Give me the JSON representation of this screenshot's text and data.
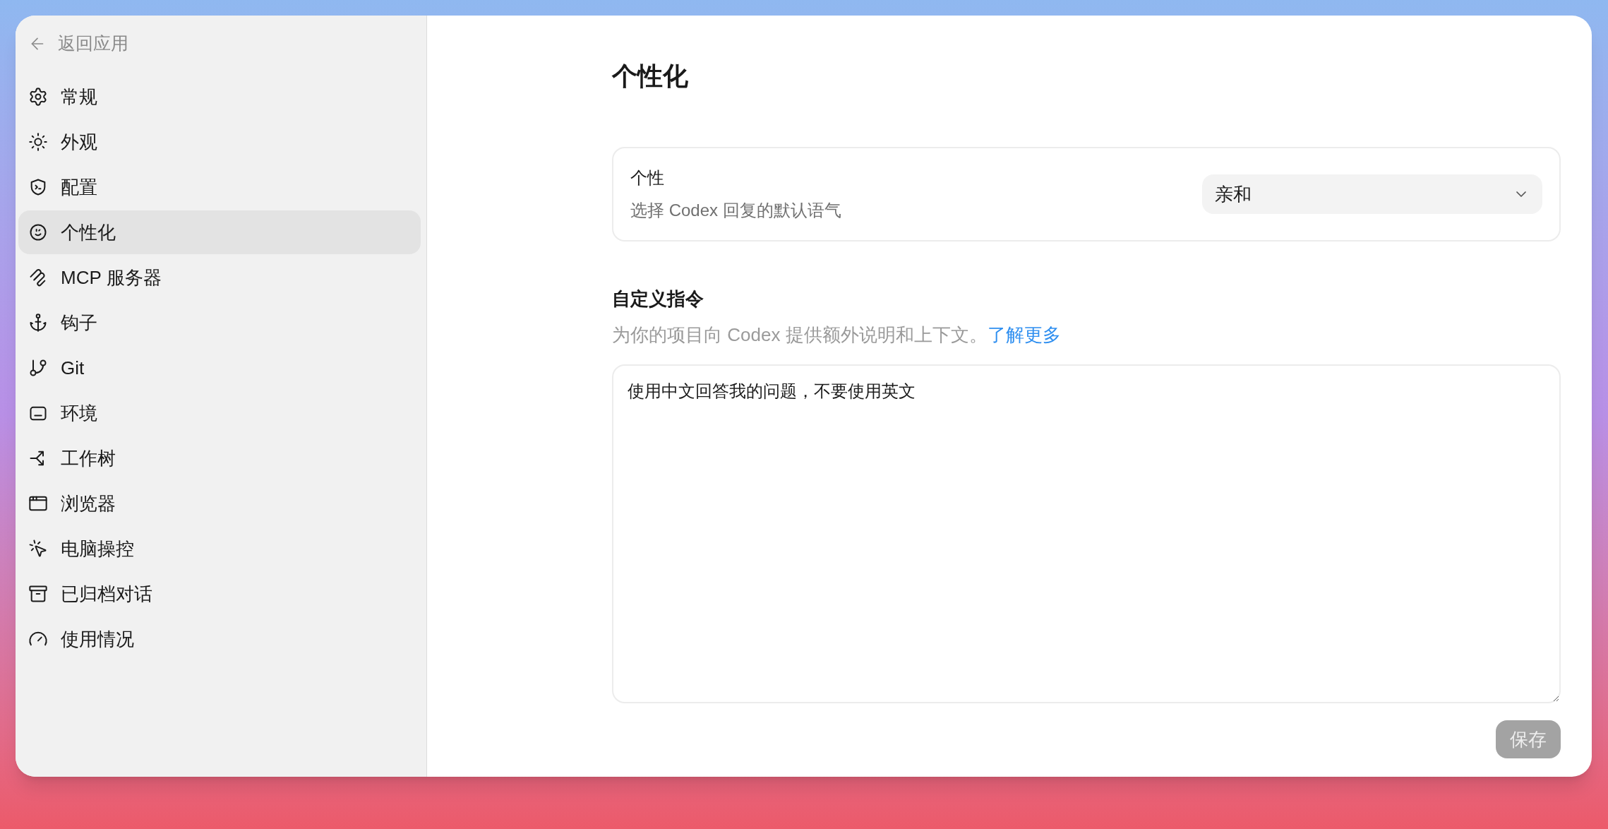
{
  "sidebar": {
    "back": "返回应用",
    "items": [
      {
        "label": "常规",
        "selected": false
      },
      {
        "label": "外观",
        "selected": false
      },
      {
        "label": "配置",
        "selected": false
      },
      {
        "label": "个性化",
        "selected": true
      },
      {
        "label": "MCP 服务器",
        "selected": false
      },
      {
        "label": "钩子",
        "selected": false
      },
      {
        "label": "Git",
        "selected": false
      },
      {
        "label": "环境",
        "selected": false
      },
      {
        "label": "工作树",
        "selected": false
      },
      {
        "label": "浏览器",
        "selected": false
      },
      {
        "label": "电脑操控",
        "selected": false
      },
      {
        "label": "已归档对话",
        "selected": false
      },
      {
        "label": "使用情况",
        "selected": false
      }
    ]
  },
  "page": {
    "title": "个性化",
    "personality": {
      "label": "个性",
      "description": "选择 Codex 回复的默认语气",
      "value": "亲和"
    },
    "custom_instructions": {
      "heading": "自定义指令",
      "description": "为你的项目向 Codex 提供额外说明和上下文。",
      "link": "了解更多",
      "value": "使用中文回答我的问题，不要使用英文"
    },
    "save_button": {
      "label": "保存",
      "disabled": true
    }
  }
}
